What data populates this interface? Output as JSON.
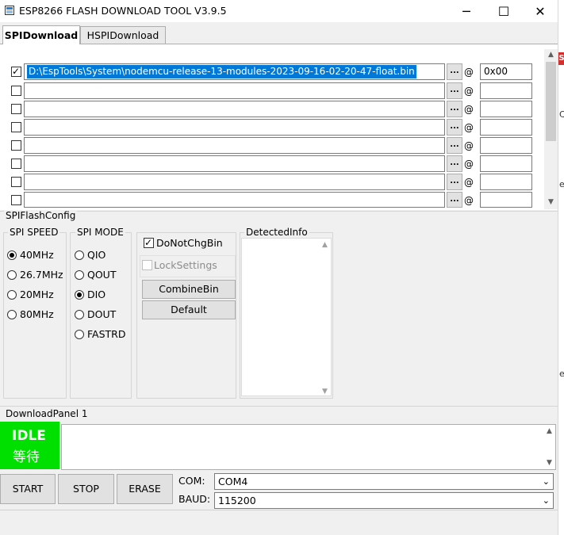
{
  "window": {
    "title": "ESP8266 FLASH DOWNLOAD TOOL V3.9.5",
    "minimize": "─",
    "maximize": "☐",
    "close": "✕"
  },
  "tabs": [
    {
      "label": "SPIDownload",
      "active": true
    },
    {
      "label": "HSPIDownload",
      "active": false
    }
  ],
  "files": [
    {
      "checked": true,
      "path": "D:\\EspTools\\System\\nodemcu-release-13-modules-2023-09-16-02-20-47-float.bin",
      "browse": "...",
      "at": "@",
      "address": "0x00"
    },
    {
      "checked": false,
      "path": "",
      "browse": "...",
      "at": "@",
      "address": ""
    },
    {
      "checked": false,
      "path": "",
      "browse": "...",
      "at": "@",
      "address": ""
    },
    {
      "checked": false,
      "path": "",
      "browse": "...",
      "at": "@",
      "address": ""
    },
    {
      "checked": false,
      "path": "",
      "browse": "...",
      "at": "@",
      "address": ""
    },
    {
      "checked": false,
      "path": "",
      "browse": "...",
      "at": "@",
      "address": ""
    },
    {
      "checked": false,
      "path": "",
      "browse": "...",
      "at": "@",
      "address": ""
    },
    {
      "checked": false,
      "path": "",
      "browse": "...",
      "at": "@",
      "address": ""
    }
  ],
  "spi_config": {
    "title": "SPIFlashConfig",
    "speed": {
      "label": "SPI SPEED",
      "options": [
        "40MHz",
        "26.7MHz",
        "20MHz",
        "80MHz"
      ],
      "selected": "40MHz"
    },
    "mode": {
      "label": "SPI MODE",
      "options": [
        "QIO",
        "QOUT",
        "DIO",
        "DOUT",
        "FASTRD"
      ],
      "selected": "DIO"
    },
    "do_not_chg_bin": {
      "label": "DoNotChgBin",
      "checked": true
    },
    "lock_settings": {
      "label": "LockSettings",
      "checked": false,
      "disabled": true
    },
    "combine_bin": "CombineBin",
    "default": "Default",
    "detected_info": "DetectedInfo"
  },
  "download_panel": {
    "title": "DownloadPanel 1",
    "state": "IDLE",
    "state_cn": "等待",
    "state_color": "#00e000",
    "start": "START",
    "stop": "STOP",
    "erase": "ERASE",
    "com_label": "COM:",
    "com_value": "COM4",
    "baud_label": "BAUD:",
    "baud_value": "115200"
  },
  "background_window": {
    "badge": "S",
    "badge_color": "#d32f2f",
    "fragments": [
      "C",
      "e",
      "e"
    ]
  },
  "colors": {
    "selection": "#0078d7",
    "path_highlight": "#00e600"
  }
}
